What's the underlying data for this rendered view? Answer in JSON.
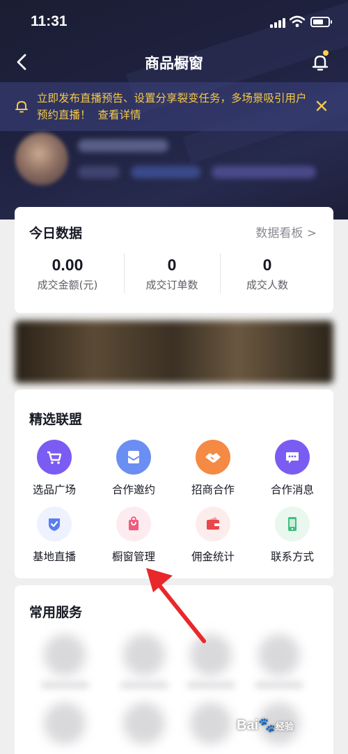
{
  "status": {
    "time": "11:31"
  },
  "nav": {
    "title": "商品橱窗"
  },
  "notice": {
    "text": "立即发布直播预告、设置分享裂变任务，多场景吸引用户预约直播！",
    "link": "查看详情"
  },
  "today": {
    "title": "今日数据",
    "dashboard_link": "数据看板 >",
    "stats": [
      {
        "value": "0.00",
        "label": "成交金额(元)"
      },
      {
        "value": "0",
        "label": "成交订单数"
      },
      {
        "value": "0",
        "label": "成交人数"
      }
    ]
  },
  "alliance": {
    "title": "精选联盟",
    "items": [
      {
        "label": "选品广场",
        "icon": "cart-icon",
        "color": "#7b5cf2"
      },
      {
        "label": "合作邀约",
        "icon": "mail-icon",
        "color": "#6a8ef2"
      },
      {
        "label": "招商合作",
        "icon": "handshake-icon",
        "color": "#f48a43"
      },
      {
        "label": "合作消息",
        "icon": "chat-icon",
        "color": "#7b5cf2"
      },
      {
        "label": "基地直播",
        "icon": "shield-check-icon",
        "color": "#5a7df0"
      },
      {
        "label": "橱窗管理",
        "icon": "shopping-bag-icon",
        "color": "#f05b7e"
      },
      {
        "label": "佣金统计",
        "icon": "wallet-icon",
        "color": "#e8484a"
      },
      {
        "label": "联系方式",
        "icon": "phone-icon",
        "color": "#3fbf7f"
      }
    ]
  },
  "services": {
    "title": "常用服务"
  },
  "watermark": {
    "text": "Bai",
    "suffix": "经验"
  }
}
